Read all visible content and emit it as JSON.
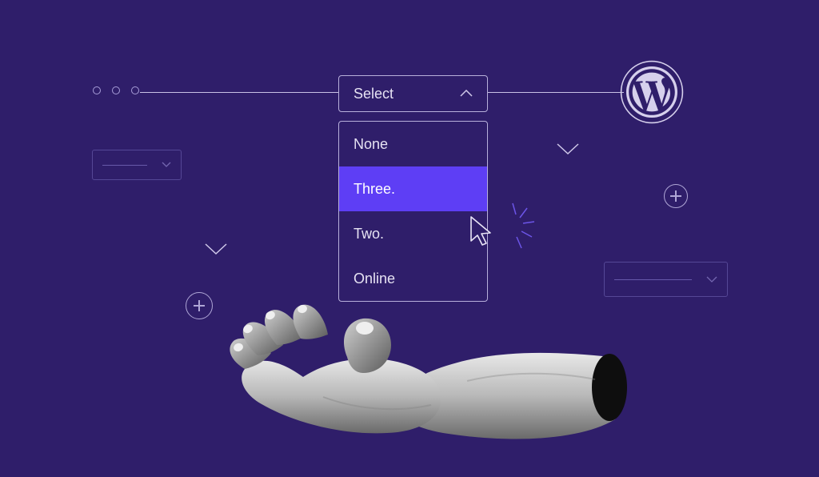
{
  "colors": {
    "bg": "#2F1E6A",
    "accent": "#5E3EF5",
    "line": "#C9C2E6",
    "outline": "#B8B0DB",
    "ghost": "#5A4C9B",
    "text": "#E6E2F3"
  },
  "select": {
    "label": "Select",
    "options": [
      "None",
      "Three.",
      "Two.",
      "Online"
    ],
    "active_index": 1
  },
  "icons": {
    "wordpress": "wordpress-icon",
    "cursor": "cursor-icon",
    "plus": "plus-icon",
    "chevron_up": "chevron-up-icon",
    "chevron_down": "chevron-down-icon",
    "ellipsis": "ellipsis-icon"
  }
}
